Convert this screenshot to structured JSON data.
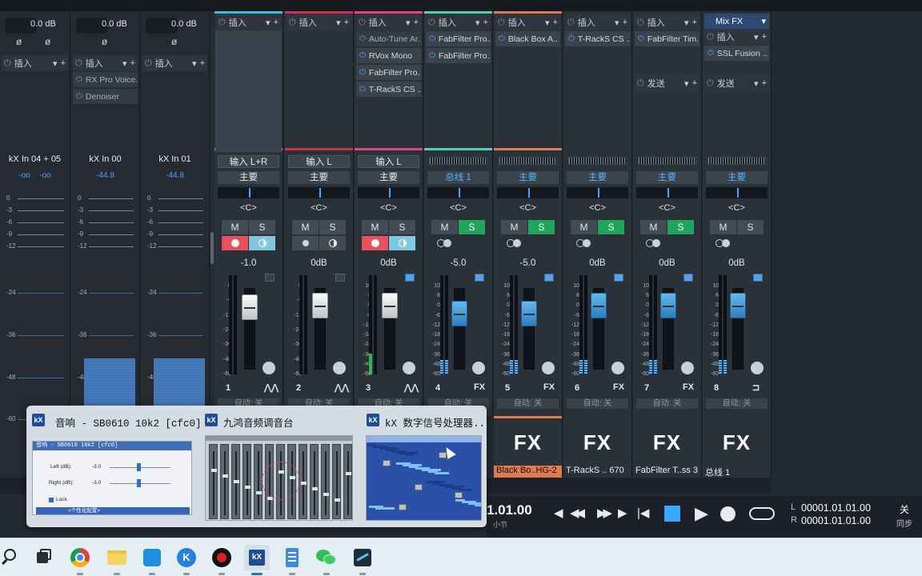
{
  "colors": {
    "ch1": "#3fb8e8",
    "ch2": "#d1304b",
    "ch3": "#e0447a",
    "ch4": "#4fd0b0",
    "ch5": "#e07b50",
    "accent_blue": "#4aa3ff",
    "solo_green": "#1fa65a"
  },
  "input_channels": [
    {
      "name": "kX In 04 + 05",
      "db_left": "-oo",
      "db_right": "-oo",
      "knob": "0.0 dB",
      "insert_label": "插入",
      "plugins": []
    },
    {
      "name": "kX In 00",
      "db": "-44.8",
      "knob": "0.0 dB",
      "insert_label": "插入",
      "plugins": [
        "RX Pro Voice..",
        "Denoiser"
      ]
    },
    {
      "name": "kX In 01",
      "db": "-44.8",
      "knob": "0.0 dB",
      "insert_label": "插入",
      "plugins": []
    }
  ],
  "input_scale": [
    "0",
    "-3",
    "-6",
    "-9",
    "-12",
    "-24",
    "-36",
    "-48",
    "-60"
  ],
  "channels": [
    {
      "num": "1",
      "insert_label": "插入",
      "plugins": [],
      "input": "输入 L+R",
      "output": "主要",
      "pan": "<C>",
      "mute": "M",
      "solo": "S",
      "volume": "-1.0",
      "auto": "自动: 关",
      "bottom_icon": "wave-icon"
    },
    {
      "num": "2",
      "insert_label": "插入",
      "plugins": [],
      "input": "输入 L",
      "output": "主要",
      "pan": "<C>",
      "mute": "M",
      "solo": "S",
      "volume": "0dB",
      "auto": "自动: 关",
      "bottom_icon": "wave-icon"
    },
    {
      "num": "3",
      "insert_label": "插入",
      "plugins": [
        "Auto-Tune Ar..",
        "RVox Mono",
        "FabFilter Pro..",
        "T-RackS CS .."
      ],
      "input": "输入 L",
      "output": "主要",
      "pan": "<C>",
      "mute": "M",
      "solo": "S",
      "volume": "0dB",
      "auto": "自动: 关",
      "bottom_icon": "wave-icon"
    },
    {
      "num": "4",
      "insert_label": "插入",
      "plugins": [
        "FabFilter Pro..",
        "FabFilter Pro.."
      ],
      "output": "总线 1",
      "pan": "<C>",
      "mute": "M",
      "solo": "S",
      "volume": "-5.0",
      "auto": "自动: 关",
      "bottom_icon": "FX"
    },
    {
      "num": "5",
      "insert_label": "插入",
      "plugins": [
        "Black Box A.."
      ],
      "output": "主要",
      "pan": "<C>",
      "mute": "M",
      "solo": "S",
      "volume": "-5.0",
      "auto": "自动: 关",
      "bottom_icon": "FX",
      "fx_name": "Black Bo..HG-2",
      "fx_big": "FX"
    },
    {
      "num": "6",
      "insert_label": "插入",
      "plugins": [
        "T-RackS CS .."
      ],
      "output": "主要",
      "pan": "<C>",
      "mute": "M",
      "solo": "S",
      "volume": "0dB",
      "auto": "自动: 关",
      "bottom_icon": "FX",
      "fx_name": "T-RackS .. 670",
      "fx_big": "FX"
    },
    {
      "num": "7",
      "insert_label": "插入",
      "plugins": [
        "FabFilter Tim.."
      ],
      "send_label": "发送",
      "output": "主要",
      "pan": "<C>",
      "mute": "M",
      "solo": "S",
      "volume": "0dB",
      "auto": "自动: 关",
      "bottom_icon": "FX",
      "fx_name": "FabFilter T..ss 3",
      "fx_big": "FX"
    },
    {
      "num": "8",
      "header": "Mix FX",
      "insert_label": "插入",
      "plugins": [
        "SSL Fusion .."
      ],
      "send_label": "发送",
      "output": "主要",
      "pan": "<C>",
      "mute": "M",
      "solo": "S",
      "volume": "0dB",
      "auto": "自动: 关",
      "bottom_icon": "bus-icon",
      "fx_name": "总线 1",
      "fx_big": "FX"
    }
  ],
  "fader_scale": [
    "10",
    "6",
    "0",
    "-6",
    "-12",
    "-18",
    "-24",
    "-36",
    "-48",
    "-60"
  ],
  "fader_scale_small": [
    "0",
    "-6",
    "-12",
    "-24",
    "-36",
    "-48",
    "-60"
  ],
  "popup": {
    "items": [
      {
        "title": "音响 - SB0610 10k2 [cfc0]",
        "thumb": {
          "window_title": "音响 - SB0610 10k2 [cfc0]",
          "left_label": "Left (dB):",
          "left_value": "-3.0",
          "right_label": "Right (dB):",
          "right_value": "-3.0",
          "lock": "Lock",
          "footer": "<个性化配置>"
        }
      },
      {
        "title": "九鸿音频调音台"
      },
      {
        "title": "kX 数字信号处理器..."
      }
    ]
  },
  "transport": {
    "position": "1.01.00",
    "small_label": "小节",
    "loop_l_label": "L",
    "loop_l": "00001.01.01.00",
    "loop_r_label": "R",
    "loop_r": "00001.01.01.00",
    "sync_top": "关",
    "sync_bottom": "同步"
  },
  "taskbar": [
    "search-icon",
    "task-view-icon",
    "chrome-icon",
    "file-explorer-icon",
    "app-icon",
    "kugou-icon",
    "recorder-icon",
    "kx-icon",
    "notepad-icon",
    "wechat-icon",
    "studio-one-icon"
  ]
}
